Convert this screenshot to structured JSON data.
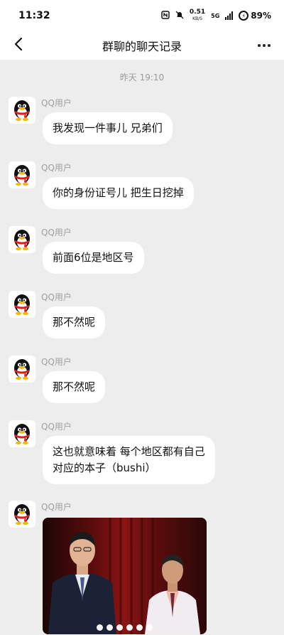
{
  "status_bar": {
    "time": "11:32",
    "net_speed": "0.51",
    "net_unit": "KB/S",
    "network": "5G",
    "battery": "89%"
  },
  "header": {
    "title": "群聊的聊天记录",
    "back_icon": "chevron-left-icon",
    "more_icon": "more-dots-icon"
  },
  "timestamp": "昨天 19:10",
  "messages": [
    {
      "sender": "QQ用户",
      "text": "我发现一件事儿 兄弟们"
    },
    {
      "sender": "QQ用户",
      "text": "你的身份证号儿 把生日挖掉"
    },
    {
      "sender": "QQ用户",
      "text": "前面6位是地区号"
    },
    {
      "sender": "QQ用户",
      "text": "那不然呢"
    },
    {
      "sender": "QQ用户",
      "text": "那不然呢"
    },
    {
      "sender": "QQ用户",
      "text_line1": "这也就意味着 每个地区都有自己",
      "text_line2": "对应的本子（bushi）"
    },
    {
      "sender": "QQ用户",
      "image": "photo-two-men-on-stage",
      "dot_count": 6
    }
  ],
  "colors": {
    "background": "#ededed",
    "bubble": "#ffffff",
    "muted_text": "#9a9a9a"
  }
}
